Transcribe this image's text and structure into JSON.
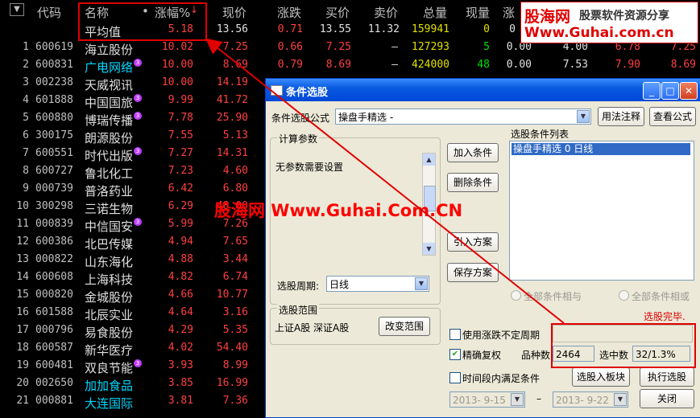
{
  "header": {
    "toggle": "▼",
    "code": "代码",
    "name": "名称",
    "dot": "•",
    "change_pct": "涨幅%",
    "sort_arrow": "↓",
    "price": "现价",
    "change": "涨跌",
    "bid": "买价",
    "ask": "卖价",
    "volume": "总量",
    "cur_vol": "现量",
    "rise_speed": "涨"
  },
  "average_row": {
    "name": "平均值",
    "change_pct": "5.18",
    "price": "13.56",
    "change": "0.71",
    "bid": "13.55",
    "ask": "11.32",
    "volume": "159941",
    "cur_vol": "0",
    "extra": "0"
  },
  "rows": [
    {
      "n": "1",
      "code": "600619",
      "name": "海立股份",
      "chg": "10.02",
      "price": "7.25",
      "d": "0.66",
      "bid": "7.25",
      "ask": "–",
      "vol": "127293",
      "cur": "5",
      "x1": "0.00",
      "x2": "4.00",
      "x3": "6.78",
      "x4": "7.25"
    },
    {
      "n": "2",
      "code": "600831",
      "name": "广电网络",
      "badge": true,
      "cyan": true,
      "chg": "10.00",
      "price": "8.69",
      "d": "0.79",
      "bid": "8.69",
      "ask": "–",
      "vol": "424000",
      "cur": "48",
      "x1": "0.00",
      "x2": "7.53",
      "x3": "7.90",
      "x4": "8.69"
    },
    {
      "n": "3",
      "code": "002238",
      "name": "天威视讯",
      "chg": "10.00",
      "price": "14.19"
    },
    {
      "n": "4",
      "code": "601888",
      "name": "中国国旅",
      "badge": true,
      "chg": "9.99",
      "price": "41.72"
    },
    {
      "n": "5",
      "code": "600880",
      "name": "博瑞传播",
      "badge": true,
      "chg": "7.78",
      "price": "25.90"
    },
    {
      "n": "6",
      "code": "300175",
      "name": "朗源股份",
      "chg": "7.55",
      "price": "5.13"
    },
    {
      "n": "7",
      "code": "600551",
      "name": "时代出版",
      "badge": true,
      "chg": "7.27",
      "price": "14.31"
    },
    {
      "n": "8",
      "code": "600727",
      "name": "鲁北化工",
      "chg": "7.23",
      "price": "4.60"
    },
    {
      "n": "9",
      "code": "000739",
      "name": "普洛药业",
      "chg": "6.42",
      "price": "6.80"
    },
    {
      "n": "10",
      "code": "300298",
      "name": "三诺生物",
      "chg": "6.29",
      "price": "48.00"
    },
    {
      "n": "11",
      "code": "000839",
      "name": "中信国安",
      "badge": true,
      "chg": "5.99",
      "price": "7.26"
    },
    {
      "n": "12",
      "code": "600386",
      "name": "北巴传媒",
      "chg": "4.94",
      "price": "7.65"
    },
    {
      "n": "13",
      "code": "000822",
      "name": "山东海化",
      "chg": "4.88",
      "price": "3.44"
    },
    {
      "n": "14",
      "code": "600608",
      "name": "上海科技",
      "chg": "4.82",
      "price": "6.74"
    },
    {
      "n": "15",
      "code": "000820",
      "name": "金城股份",
      "chg": "4.66",
      "price": "10.77"
    },
    {
      "n": "16",
      "code": "601588",
      "name": "北辰实业",
      "chg": "4.64",
      "price": "3.16"
    },
    {
      "n": "17",
      "code": "000796",
      "name": "易食股份",
      "chg": "4.29",
      "price": "5.35"
    },
    {
      "n": "18",
      "code": "600587",
      "name": "新华医疗",
      "chg": "4.02",
      "price": "54.40"
    },
    {
      "n": "19",
      "code": "600481",
      "name": "双良节能",
      "badge": true,
      "chg": "3.93",
      "price": "8.99"
    },
    {
      "n": "20",
      "code": "002650",
      "name": "加加食品",
      "cyan": true,
      "chg": "3.85",
      "price": "16.99"
    },
    {
      "n": "21",
      "code": "000881",
      "name": "大连国际",
      "cyan": true,
      "chg": "3.81",
      "price": "7.36"
    }
  ],
  "watermark": {
    "top_brand": "股海网",
    "top_slogan": "股票软件资源分享",
    "top_url": "Www.Guhai.com.cn",
    "center": "股海网 Www.Guhai.Com.CN"
  },
  "dialog": {
    "title": "条件选股",
    "formula_label": "条件选股公式",
    "formula_value": "操盘手精选 -",
    "usage_button": "用法注释",
    "view_formula_button": "查看公式",
    "params_group": "计算参数",
    "params_text": "无参数需要设置",
    "conditions_list_label": "选股条件列表",
    "conditions": [
      "操盘手精选  0  日线"
    ],
    "add_condition": "加入条件",
    "delete_condition": "删除条件",
    "import_plan": "引入方案",
    "save_plan": "保存方案",
    "period_label": "选股周期:",
    "period_value": "日线",
    "radio_and": "全部条件相与",
    "radio_or": "全部条件相或",
    "status": "选股完毕.",
    "range_group": "选股范围",
    "range_text": "上证A股 深证A股",
    "change_range": "改变范围",
    "opt_no_limit": "使用涨跌不定周期",
    "opt_exact": "精确复权",
    "stock_count_label": "品种数",
    "stock_count": "2464",
    "selected_label": "选中数",
    "selected_value": "32/1.3%",
    "opt_time_range": "时间段内满足条件",
    "date_from": "2013- 9-15",
    "date_to": "2013- 9-22",
    "dash": "–",
    "select_into_block": "选股入板块",
    "execute": "执行选股",
    "close": "关闭"
  }
}
